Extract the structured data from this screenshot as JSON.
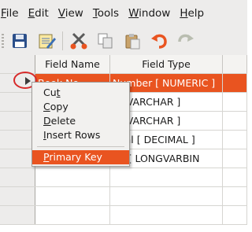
{
  "menubar": {
    "items": [
      {
        "label": "File",
        "u": "F",
        "rest": "ile"
      },
      {
        "label": "Edit",
        "u": "E",
        "rest": "dit"
      },
      {
        "label": "View",
        "u": "V",
        "rest": "iew"
      },
      {
        "label": "Tools",
        "u": "T",
        "rest": "ools"
      },
      {
        "label": "Window",
        "u": "W",
        "rest": "indow"
      },
      {
        "label": "Help",
        "u": "H",
        "rest": "elp"
      }
    ]
  },
  "toolbar": {
    "icons": [
      "save-icon",
      "edit-icon",
      "cut-icon",
      "copy-icon",
      "paste-icon",
      "undo-icon",
      "redo-icon"
    ]
  },
  "table": {
    "headers": {
      "field_name": "Field Name",
      "field_type": "Field Type"
    },
    "rows": [
      {
        "name": "Book No",
        "type": "Number [ NUMERIC ]"
      },
      {
        "name": "",
        "type": "t [ VARCHAR ]"
      },
      {
        "name": "",
        "type": "t [ VARCHAR ]"
      },
      {
        "name": "",
        "type": "imal [ DECIMAL ]"
      },
      {
        "name": "",
        "type": "ge [ LONGVARBIN"
      }
    ]
  },
  "context_menu": {
    "cut": {
      "pre": "Cu",
      "u": "t",
      "post": ""
    },
    "copy": {
      "pre": "",
      "u": "C",
      "post": "opy"
    },
    "delete": {
      "pre": "",
      "u": "D",
      "post": "elete"
    },
    "insert_rows": {
      "pre": "",
      "u": "I",
      "post": "nsert Rows"
    },
    "primary_key": {
      "pre": "",
      "u": "P",
      "post": "rimary Key"
    }
  },
  "colors": {
    "accent": "#e95420",
    "annotation": "#d72a2a"
  }
}
